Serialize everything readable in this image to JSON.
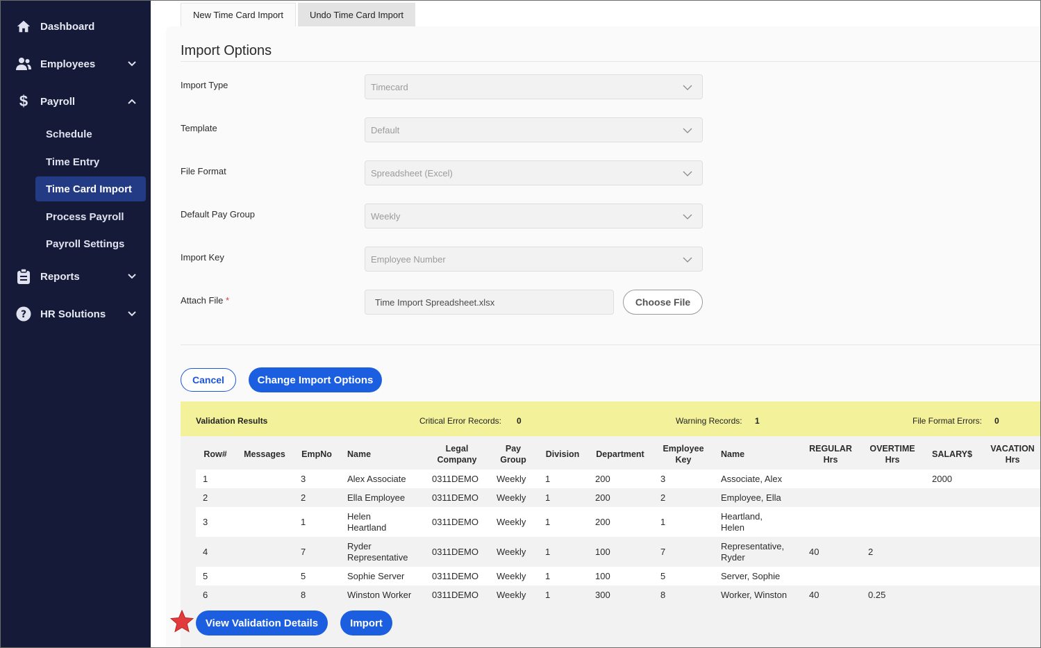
{
  "sidebar": {
    "items": [
      {
        "label": "Dashboard",
        "icon": "home-icon"
      },
      {
        "label": "Employees",
        "icon": "people-icon"
      },
      {
        "label": "Payroll",
        "icon": "dollar-icon"
      },
      {
        "label": "Reports",
        "icon": "clipboard-icon"
      },
      {
        "label": "HR Solutions",
        "icon": "help-circle-icon"
      }
    ],
    "payroll_sub": [
      "Schedule",
      "Time Entry",
      "Time Card Import",
      "Process Payroll",
      "Payroll Settings"
    ],
    "active_sub": "Time Card Import"
  },
  "tabs": {
    "new_import": "New Time Card Import",
    "undo_import": "Undo Time Card Import"
  },
  "import_options": {
    "title": "Import Options",
    "fields": [
      {
        "label": "Import Type",
        "value": "Timecard"
      },
      {
        "label": "Template",
        "value": "Default"
      },
      {
        "label": "File Format",
        "value": "Spreadsheet (Excel)"
      },
      {
        "label": "Default Pay Group",
        "value": "Weekly"
      },
      {
        "label": "Import Key",
        "value": "Employee Number"
      }
    ],
    "attach_file": {
      "label": "Attach File",
      "required_mark": "*",
      "value": "Time Import Spreadsheet.xlsx",
      "button": "Choose File"
    }
  },
  "actions": {
    "cancel": "Cancel",
    "change": "Change Import Options",
    "view_details": "View Validation Details",
    "import": "Import"
  },
  "validation": {
    "title": "Validation Results",
    "critical_label": "Critical Error Records:",
    "critical_value": "0",
    "warning_label": "Warning Records:",
    "warning_value": "1",
    "format_label": "File Format Errors:",
    "format_value": "0"
  },
  "table": {
    "headers": [
      "Row#",
      "Messages",
      "EmpNo",
      "Name",
      "Legal Company",
      "Pay Group",
      "Division",
      "Department",
      "Employee Key",
      "Name",
      "REGULAR Hrs",
      "OVERTIME Hrs",
      "SALARY$",
      "VACATION Hrs"
    ],
    "header_lines": [
      [
        "Row#"
      ],
      [
        "Messages"
      ],
      [
        "EmpNo"
      ],
      [
        "Name"
      ],
      [
        "Legal",
        "Company"
      ],
      [
        "Pay",
        "Group"
      ],
      [
        "Division"
      ],
      [
        "Department"
      ],
      [
        "Employee",
        "Key"
      ],
      [
        "Name"
      ],
      [
        "REGULAR",
        "Hrs"
      ],
      [
        "OVERTIME",
        "Hrs"
      ],
      [
        "SALARY$"
      ],
      [
        "VACATION",
        "Hrs"
      ]
    ],
    "rows": [
      {
        "row": "1",
        "messages": "",
        "empno": "3",
        "name": [
          "Alex Associate"
        ],
        "company": "0311DEMO",
        "paygroup": "Weekly",
        "division": "1",
        "department": "200",
        "empkey": "3",
        "name2": [
          "Associate, Alex"
        ],
        "regular": "",
        "overtime": "",
        "salary": "2000",
        "vacation": ""
      },
      {
        "row": "2",
        "messages": "",
        "empno": "2",
        "name": [
          "Ella Employee"
        ],
        "company": "0311DEMO",
        "paygroup": "Weekly",
        "division": "1",
        "department": "200",
        "empkey": "2",
        "name2": [
          "Employee, Ella"
        ],
        "regular": "",
        "overtime": "",
        "salary": "",
        "vacation": ""
      },
      {
        "row": "3",
        "messages": "",
        "empno": "1",
        "name": [
          "Helen",
          "Heartland"
        ],
        "company": "0311DEMO",
        "paygroup": "Weekly",
        "division": "1",
        "department": "200",
        "empkey": "1",
        "name2": [
          "Heartland,",
          "Helen"
        ],
        "regular": "",
        "overtime": "",
        "salary": "",
        "vacation": ""
      },
      {
        "row": "4",
        "messages": "",
        "empno": "7",
        "name": [
          "Ryder",
          "Representative"
        ],
        "company": "0311DEMO",
        "paygroup": "Weekly",
        "division": "1",
        "department": "100",
        "empkey": "7",
        "name2": [
          "Representative,",
          "Ryder"
        ],
        "regular": "40",
        "overtime": "2",
        "salary": "",
        "vacation": ""
      },
      {
        "row": "5",
        "messages": "",
        "empno": "5",
        "name": [
          "Sophie Server"
        ],
        "company": "0311DEMO",
        "paygroup": "Weekly",
        "division": "1",
        "department": "100",
        "empkey": "5",
        "name2": [
          "Server, Sophie"
        ],
        "regular": "",
        "overtime": "",
        "salary": "",
        "vacation": ""
      },
      {
        "row": "6",
        "messages": "",
        "empno": "8",
        "name": [
          "Winston Worker"
        ],
        "company": "0311DEMO",
        "paygroup": "Weekly",
        "division": "1",
        "department": "300",
        "empkey": "8",
        "name2": [
          "Worker, Winston"
        ],
        "regular": "40",
        "overtime": "0.25",
        "salary": "",
        "vacation": ""
      }
    ]
  },
  "colors": {
    "sidebar_bg": "#151a38",
    "active_nav": "#233a85",
    "primary": "#1b5fe0",
    "validation_bg": "#f3f29a",
    "star": "#e23b3b"
  }
}
